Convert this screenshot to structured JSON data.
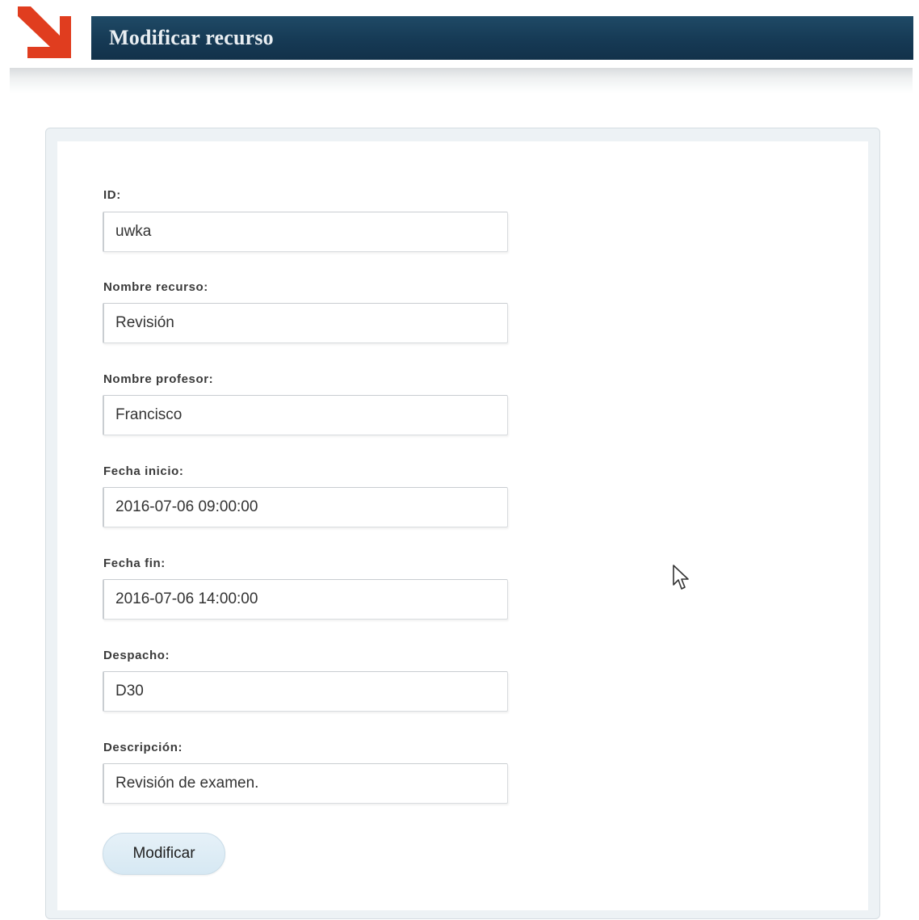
{
  "header": {
    "title": "Modificar recurso"
  },
  "form": {
    "fields": [
      {
        "label": "ID:",
        "value": "uwka"
      },
      {
        "label": "Nombre recurso:",
        "value": "Revisión"
      },
      {
        "label": "Nombre profesor:",
        "value": "Francisco"
      },
      {
        "label": "Fecha inicio:",
        "value": "2016-07-06 09:00:00"
      },
      {
        "label": "Fecha fin:",
        "value": "2016-07-06 14:00:00"
      },
      {
        "label": "Despacho:",
        "value": "D30"
      },
      {
        "label": "Descripción:",
        "value": "Revisión de examen."
      }
    ],
    "submit_label": "Modificar"
  },
  "icons": {
    "logo": "arrow-logo-icon",
    "cursor": "mouse-pointer-icon"
  },
  "colors": {
    "logo_red": "#e03d1f",
    "title_bar": "#163a55",
    "button_bg": "#d6e8f3"
  }
}
